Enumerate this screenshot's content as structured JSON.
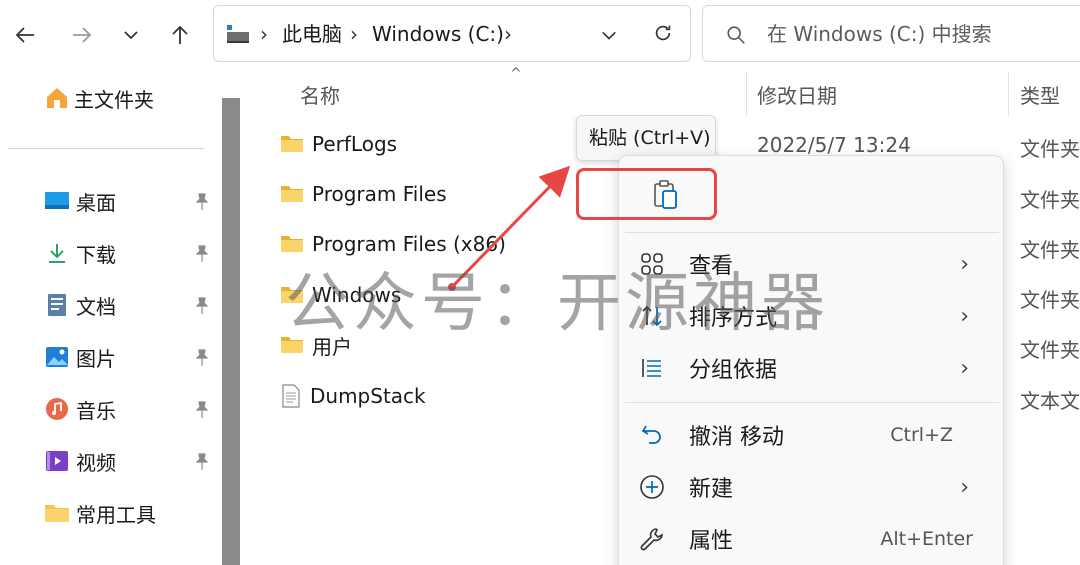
{
  "addressbar": {
    "breadcrumbs": [
      "此电脑",
      "Windows (C:)"
    ]
  },
  "search": {
    "placeholder": "在 Windows (C:) 中搜索"
  },
  "sidebar": {
    "home": "主文件夹",
    "items": [
      {
        "label": "桌面",
        "icon": "desktop-icon",
        "pinned": true
      },
      {
        "label": "下载",
        "icon": "download-icon",
        "pinned": true
      },
      {
        "label": "文档",
        "icon": "documents-icon",
        "pinned": true
      },
      {
        "label": "图片",
        "icon": "pictures-icon",
        "pinned": true
      },
      {
        "label": "音乐",
        "icon": "music-icon",
        "pinned": true
      },
      {
        "label": "视频",
        "icon": "videos-icon",
        "pinned": true
      },
      {
        "label": "常用工具",
        "icon": "folder-icon",
        "pinned": false
      }
    ]
  },
  "columns": {
    "name": "名称",
    "modified": "修改日期",
    "type": "类型"
  },
  "files": [
    {
      "name": "PerfLogs",
      "date": "2022/5/7 13:24",
      "type": "文件夹",
      "kind": "folder"
    },
    {
      "name": "Program Files",
      "date": "",
      "type": "文件夹",
      "kind": "folder"
    },
    {
      "name": "Program Files (x86)",
      "date": "",
      "type": "文件夹",
      "kind": "folder"
    },
    {
      "name": "Windows",
      "date": "",
      "type": "文件夹",
      "kind": "folder"
    },
    {
      "name": "用户",
      "date": "",
      "type": "文件夹",
      "kind": "folder"
    },
    {
      "name": "DumpStack",
      "date": "",
      "type": "文本文",
      "kind": "file"
    }
  ],
  "tooltip": {
    "paste": "粘贴 (Ctrl+V)"
  },
  "context_menu": {
    "items": [
      {
        "label": "查看",
        "shortcut": "",
        "submenu": true,
        "icon": "view-icon"
      },
      {
        "label": "排序方式",
        "shortcut": "",
        "submenu": true,
        "icon": "sort-icon"
      },
      {
        "label": "分组依据",
        "shortcut": "",
        "submenu": true,
        "icon": "group-icon"
      },
      {
        "label": "撤消 移动",
        "shortcut": "Ctrl+Z",
        "submenu": false,
        "icon": "undo-icon"
      },
      {
        "label": "新建",
        "shortcut": "",
        "submenu": true,
        "icon": "new-icon"
      },
      {
        "label": "属性",
        "shortcut": "Alt+Enter",
        "submenu": false,
        "icon": "properties-icon"
      }
    ]
  },
  "watermark": "公众号：开源神器",
  "colors": {
    "accent": "#0067c0",
    "folder": "#f4c54a",
    "highlight": "#e84545"
  }
}
